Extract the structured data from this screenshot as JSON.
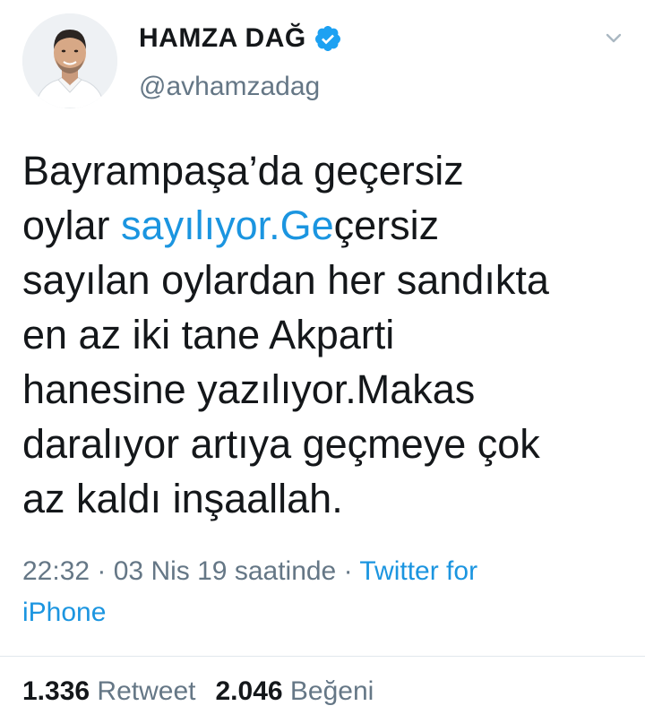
{
  "user": {
    "display_name": "HAMZA DAĞ",
    "handle": "@avhamzadag",
    "verified": true,
    "avatar_icon": "profile-photo"
  },
  "tweet": {
    "lines": [
      "Bayrampaşa’da geçersiz",
      "sayılan oylardan her sandıkta",
      "en az iki tane Akparti",
      "hanesine yazılıyor.Makas",
      "daralıyor artıya geçmeye çok",
      "az kaldı inşaallah."
    ],
    "line2_prefix": "oylar ",
    "line2_link": "sayılıyor.Ge",
    "line2_suffix": "çersiz"
  },
  "meta": {
    "time": "22:32",
    "date": "03 Nis 19 saatinde",
    "separator": " · ",
    "source_line1": "Twitter for",
    "source_line2": "iPhone"
  },
  "stats": {
    "retweets_count": "1.336",
    "retweets_label": "Retweet",
    "likes_count": "2.046",
    "likes_label": "Beğeni"
  },
  "colors": {
    "link": "#1b95e0",
    "verified": "#1da1f2",
    "muted": "#657786",
    "text": "#14171a"
  },
  "icons": {
    "verified": "verified-badge-icon",
    "menu": "chevron-down-icon"
  }
}
